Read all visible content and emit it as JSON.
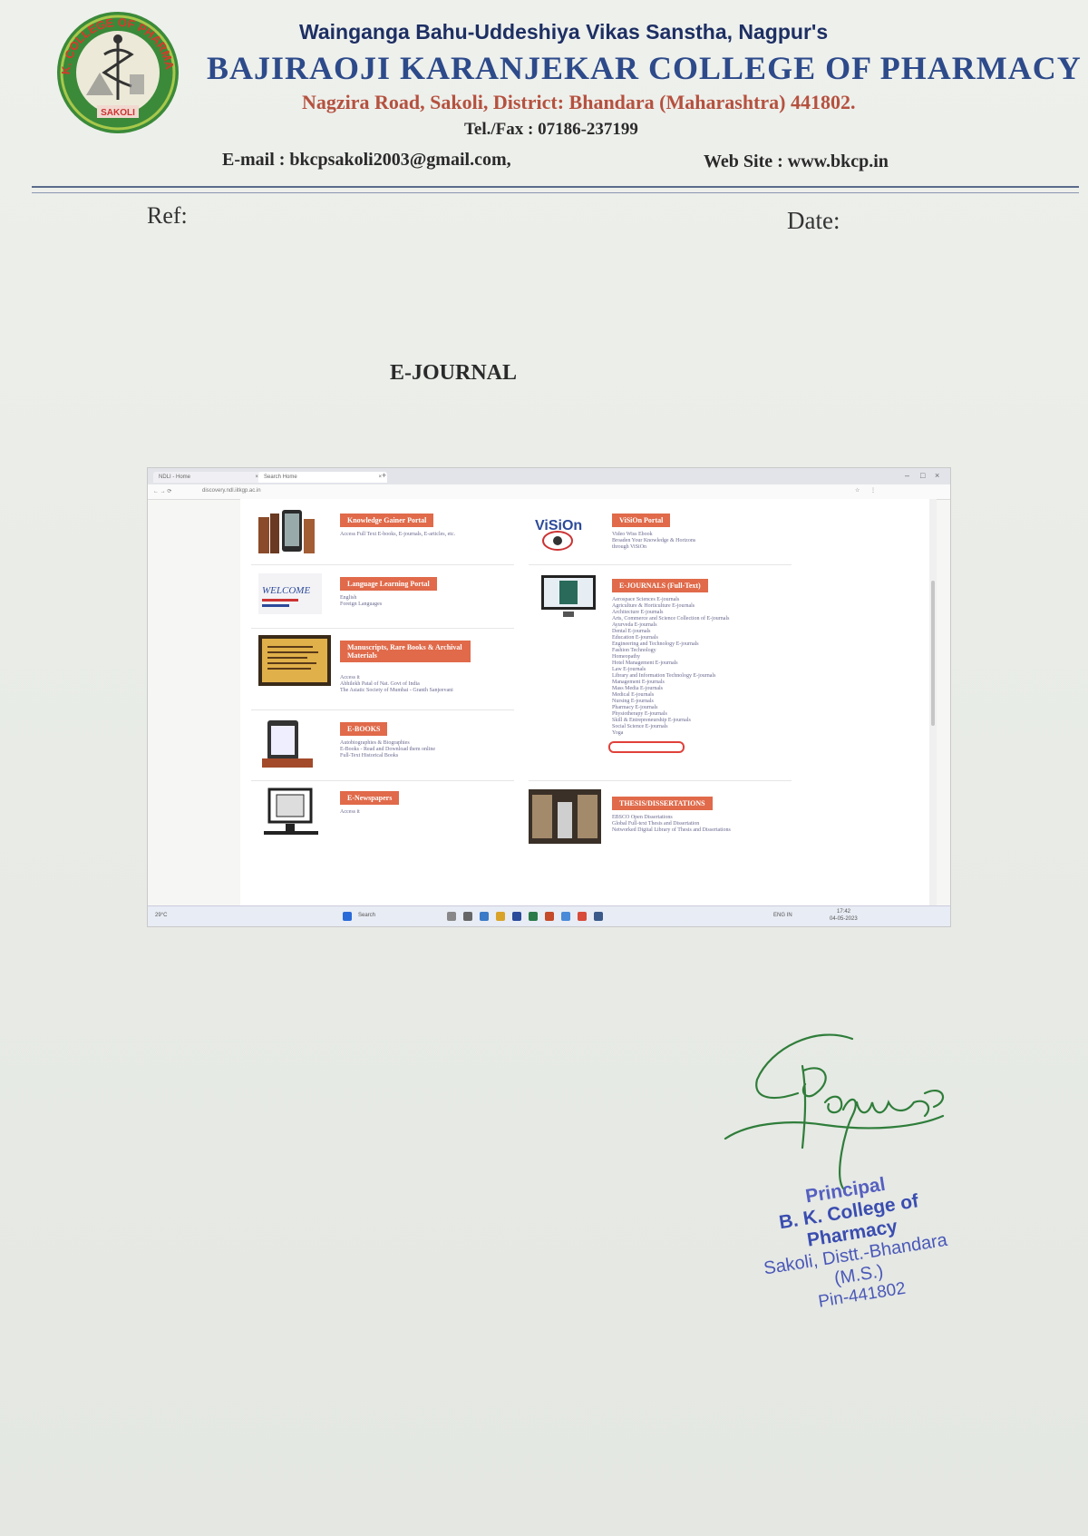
{
  "letterhead": {
    "logo_text_top": "B.K. COLLEGE OF PHARMACY",
    "logo_text_bottom": "SAKOLI",
    "organization": "Wainganga Bahu-Uddeshiya Vikas Sanstha, Nagpur's",
    "college_name": "BAJIRAOJI KARANJEKAR COLLEGE OF PHARMACY",
    "address": "Nagzira Road, Sakoli, District: Bhandara (Maharashtra) 441802.",
    "tel": "Tel./Fax : 07186-237199",
    "email": "E-mail : bkcpsakoli2003@gmail.com,",
    "website": "Web Site : www.bkcp.in"
  },
  "ref_label": "Ref:",
  "date_label": "Date:",
  "heading": "E-JOURNAL",
  "screenshot": {
    "tabs": [
      "NDLI - Home",
      "Search Home"
    ],
    "url": "discovery.ndl.iitkgp.ac.in",
    "cards": {
      "knowledge": {
        "title": "Knowledge Gainer Portal",
        "desc": "Access Full Text E-books, E-journals, E-articles, etc."
      },
      "vision": {
        "title": "ViSiOn Portal",
        "desc": "Video Wiss Ebook\nBroaden Your Knowledge & Horizons\nthrough ViSiOn"
      },
      "language": {
        "title": "Language Learning Portal",
        "desc": "English\nForeign Languages"
      },
      "ejournals": {
        "title": "E-JOURNALS (Full-Text)",
        "desc": "Aerospace Sciences E-journals\nAgriculture & Horticulture E-journals\nArchitecture E-journals\nArts, Commerce and Science Collection of E-journals\nAyurveda E-journals\nDental E-journals\nEducation E-journals\nEngineering and Technology E-journals\nFashion Technology\nHomeopathy\nHotel Management E-journals\nLaw E-journals\nLibrary and Information Technology E-journals\nManagement E-journals\nMass Media E-journals\nMedical E-journals\nNursing E-journals\nPharmacy E-journals\nPhysiotherapy E-journals\nSkill & Entrepreneurship E-journals\nSocial Science E-journals\nYoga"
      },
      "manuscripts": {
        "title": "Manuscripts, Rare Books & Archival Materials",
        "desc": "Access it\nAbhilekh Patal of Nat. Govt of India\nThe Asiatic Society of Mumbai - Granth Sanjeevani"
      },
      "ebooks": {
        "title": "E-BOOKS",
        "desc": "Autobiographies & Biographies\nE-Books - Read and Download them online\nFull-Text Historical Books"
      },
      "theses": {
        "title": "THESIS/DISSERTATIONS",
        "desc": "EBSCO Open Dissertations\nGlobal Full-text Thesis and Dissertation\nNetworked Digital Library of Thesis and Dissertations"
      },
      "newspapers": {
        "title": "E-Newspapers",
        "desc": "Access it"
      }
    },
    "taskbar": {
      "weather": "29°C",
      "search": "Search",
      "lang": "ENG IN",
      "time": "17:42",
      "date": "04-05-2023"
    }
  },
  "stamp": {
    "line1": "Principal",
    "line2": "B. K. College of Pharmacy",
    "line3": "Sakoli, Distt.-Bhandara (M.S.)",
    "line4": "Pin-441802"
  }
}
